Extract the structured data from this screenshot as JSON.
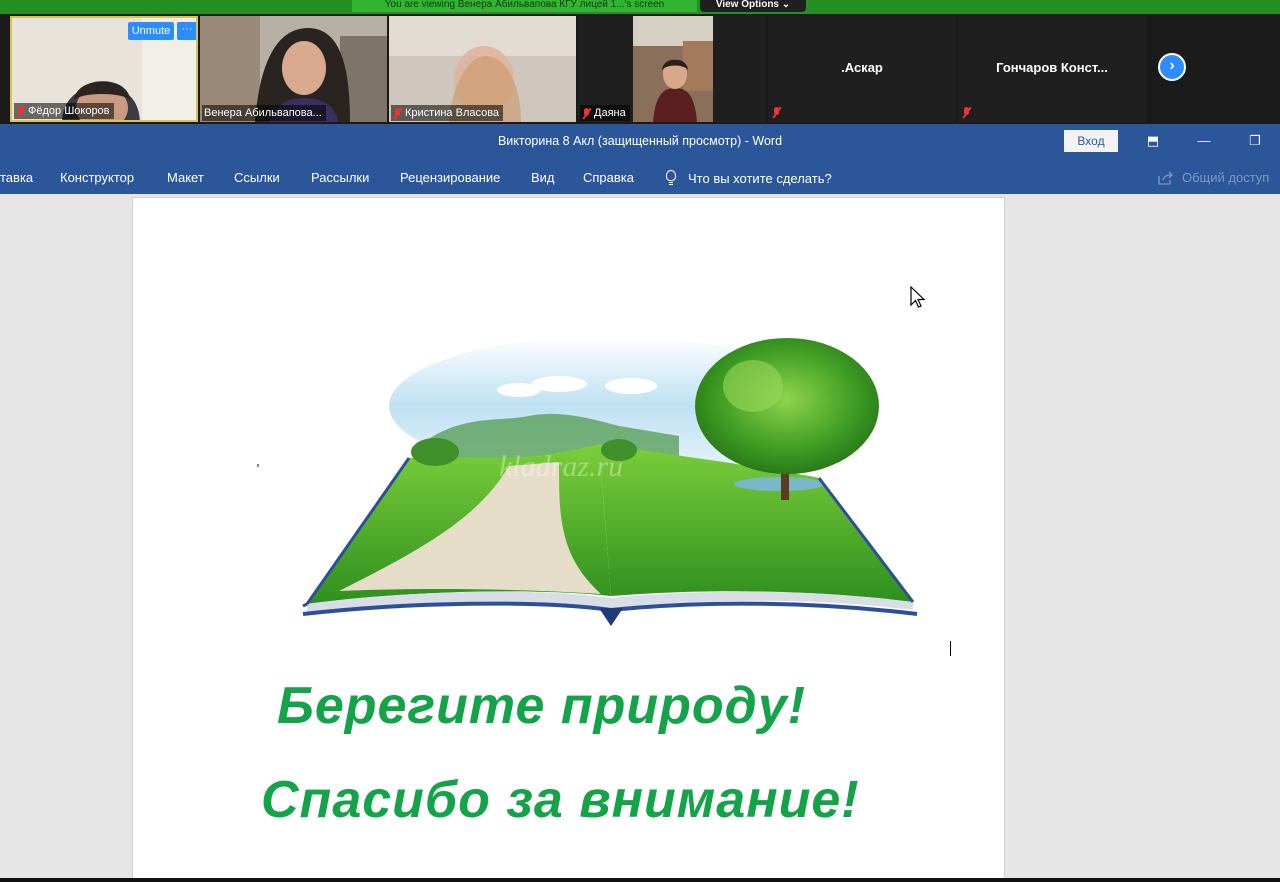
{
  "zoom": {
    "share_banner": "You are viewing Венера Абильвапова КГУ лицей 1...'s screen",
    "view_options": "View Options ⌄",
    "participants": [
      {
        "name": "Фёдор Шокоров",
        "unmute_label": "Unmute",
        "more_label": "···"
      },
      {
        "name": "Венера Абильвапова..."
      },
      {
        "name": "Кристина Власова"
      },
      {
        "name": "Даяна"
      },
      {
        "name": ".Аскар"
      },
      {
        "name": "Гончаров  Конст..."
      }
    ],
    "next_label": "›"
  },
  "word": {
    "title": "Викторина 8 Акл (защищенный просмотр)  -  Word",
    "signin_label": "Вход",
    "window_buttons": {
      "ribbon_display": "⬒",
      "minimize": "—",
      "restore": "❐"
    },
    "tabs": [
      "тавка",
      "Конструктор",
      "Макет",
      "Ссылки",
      "Рассылки",
      "Рецензирование",
      "Вид",
      "Справка"
    ],
    "tell_me": "Что вы хотите сделать?",
    "share_label": "Общий доступ"
  },
  "document": {
    "line1": "Берегите природу!",
    "line2": "Спасибо за внимание!",
    "watermark": "kladraz.ru"
  },
  "colors": {
    "word_blue": "#2b579a",
    "zoom_green": "#229122",
    "zoom_blue": "#2d8cff",
    "doc_green": "#15a34a"
  }
}
